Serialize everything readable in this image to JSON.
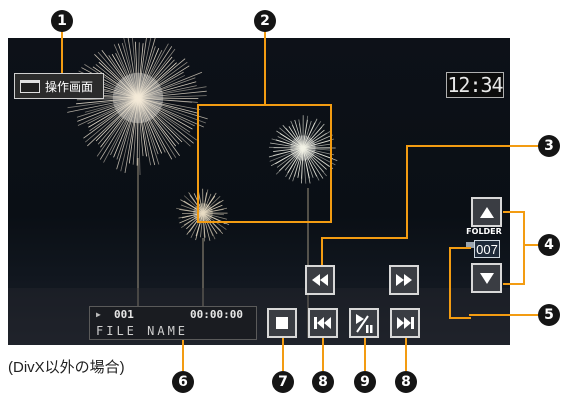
{
  "operation_button": {
    "label": "操作画面"
  },
  "clock": {
    "time": "12:34"
  },
  "info_panel": {
    "track": "001",
    "elapsed": "00:00:00",
    "file_name": "FILE NAME"
  },
  "folder": {
    "label": "FOLDER",
    "number": "007"
  },
  "note": "(DivX以外の場合)",
  "callouts": [
    "1",
    "2",
    "3",
    "4",
    "5",
    "6",
    "7",
    "8",
    "9",
    "8"
  ],
  "controls": {
    "stop": "stop-icon",
    "previous": "skip-previous-icon",
    "play_pause": "play-pause-icon",
    "next": "skip-next-icon",
    "rewind": "rewind-icon",
    "fast_forward": "fast-forward-icon",
    "folder_up": "arrow-up-icon",
    "folder_down": "arrow-down-icon"
  },
  "colors": {
    "callout_line": "#f39c12",
    "callout_badge": "#151515"
  }
}
